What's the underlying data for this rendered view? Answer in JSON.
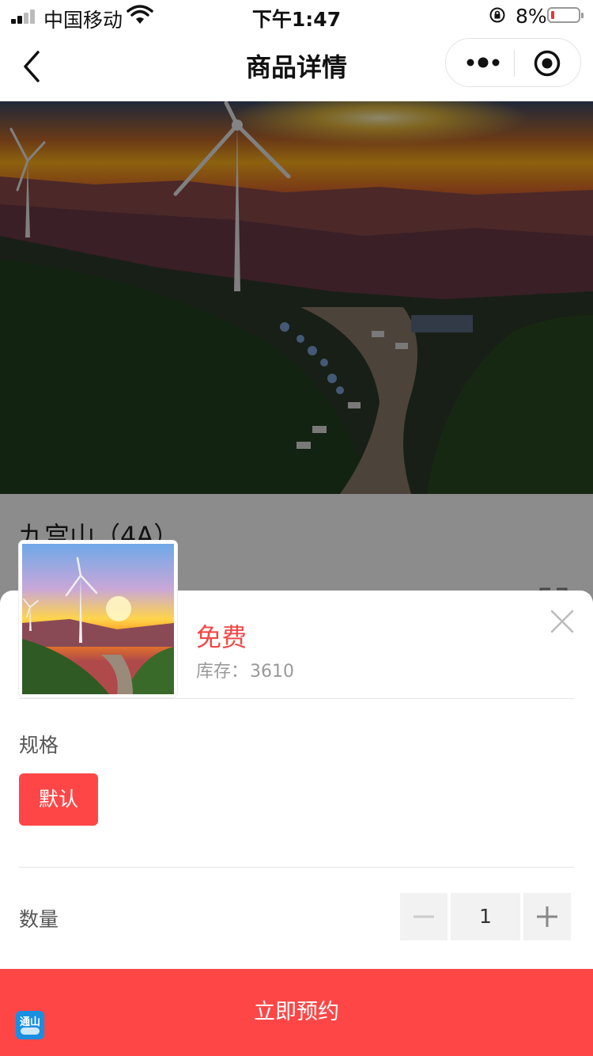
{
  "status_bar": {
    "carrier": "中国移动",
    "time": "下午1:47",
    "battery_percent": "8%"
  },
  "nav": {
    "title": "商品详情"
  },
  "product": {
    "title": "九宫山（4A）"
  },
  "sheet": {
    "price": "免费",
    "stock_label": "库存：",
    "stock_value": "3610",
    "spec_label": "规格",
    "spec_option": "默认",
    "qty_label": "数量",
    "qty_value": "1"
  },
  "cta": {
    "label": "立即预约"
  },
  "app_badge": {
    "text": "通山"
  },
  "colors": {
    "accent": "#ff4646",
    "price": "#f04848"
  }
}
